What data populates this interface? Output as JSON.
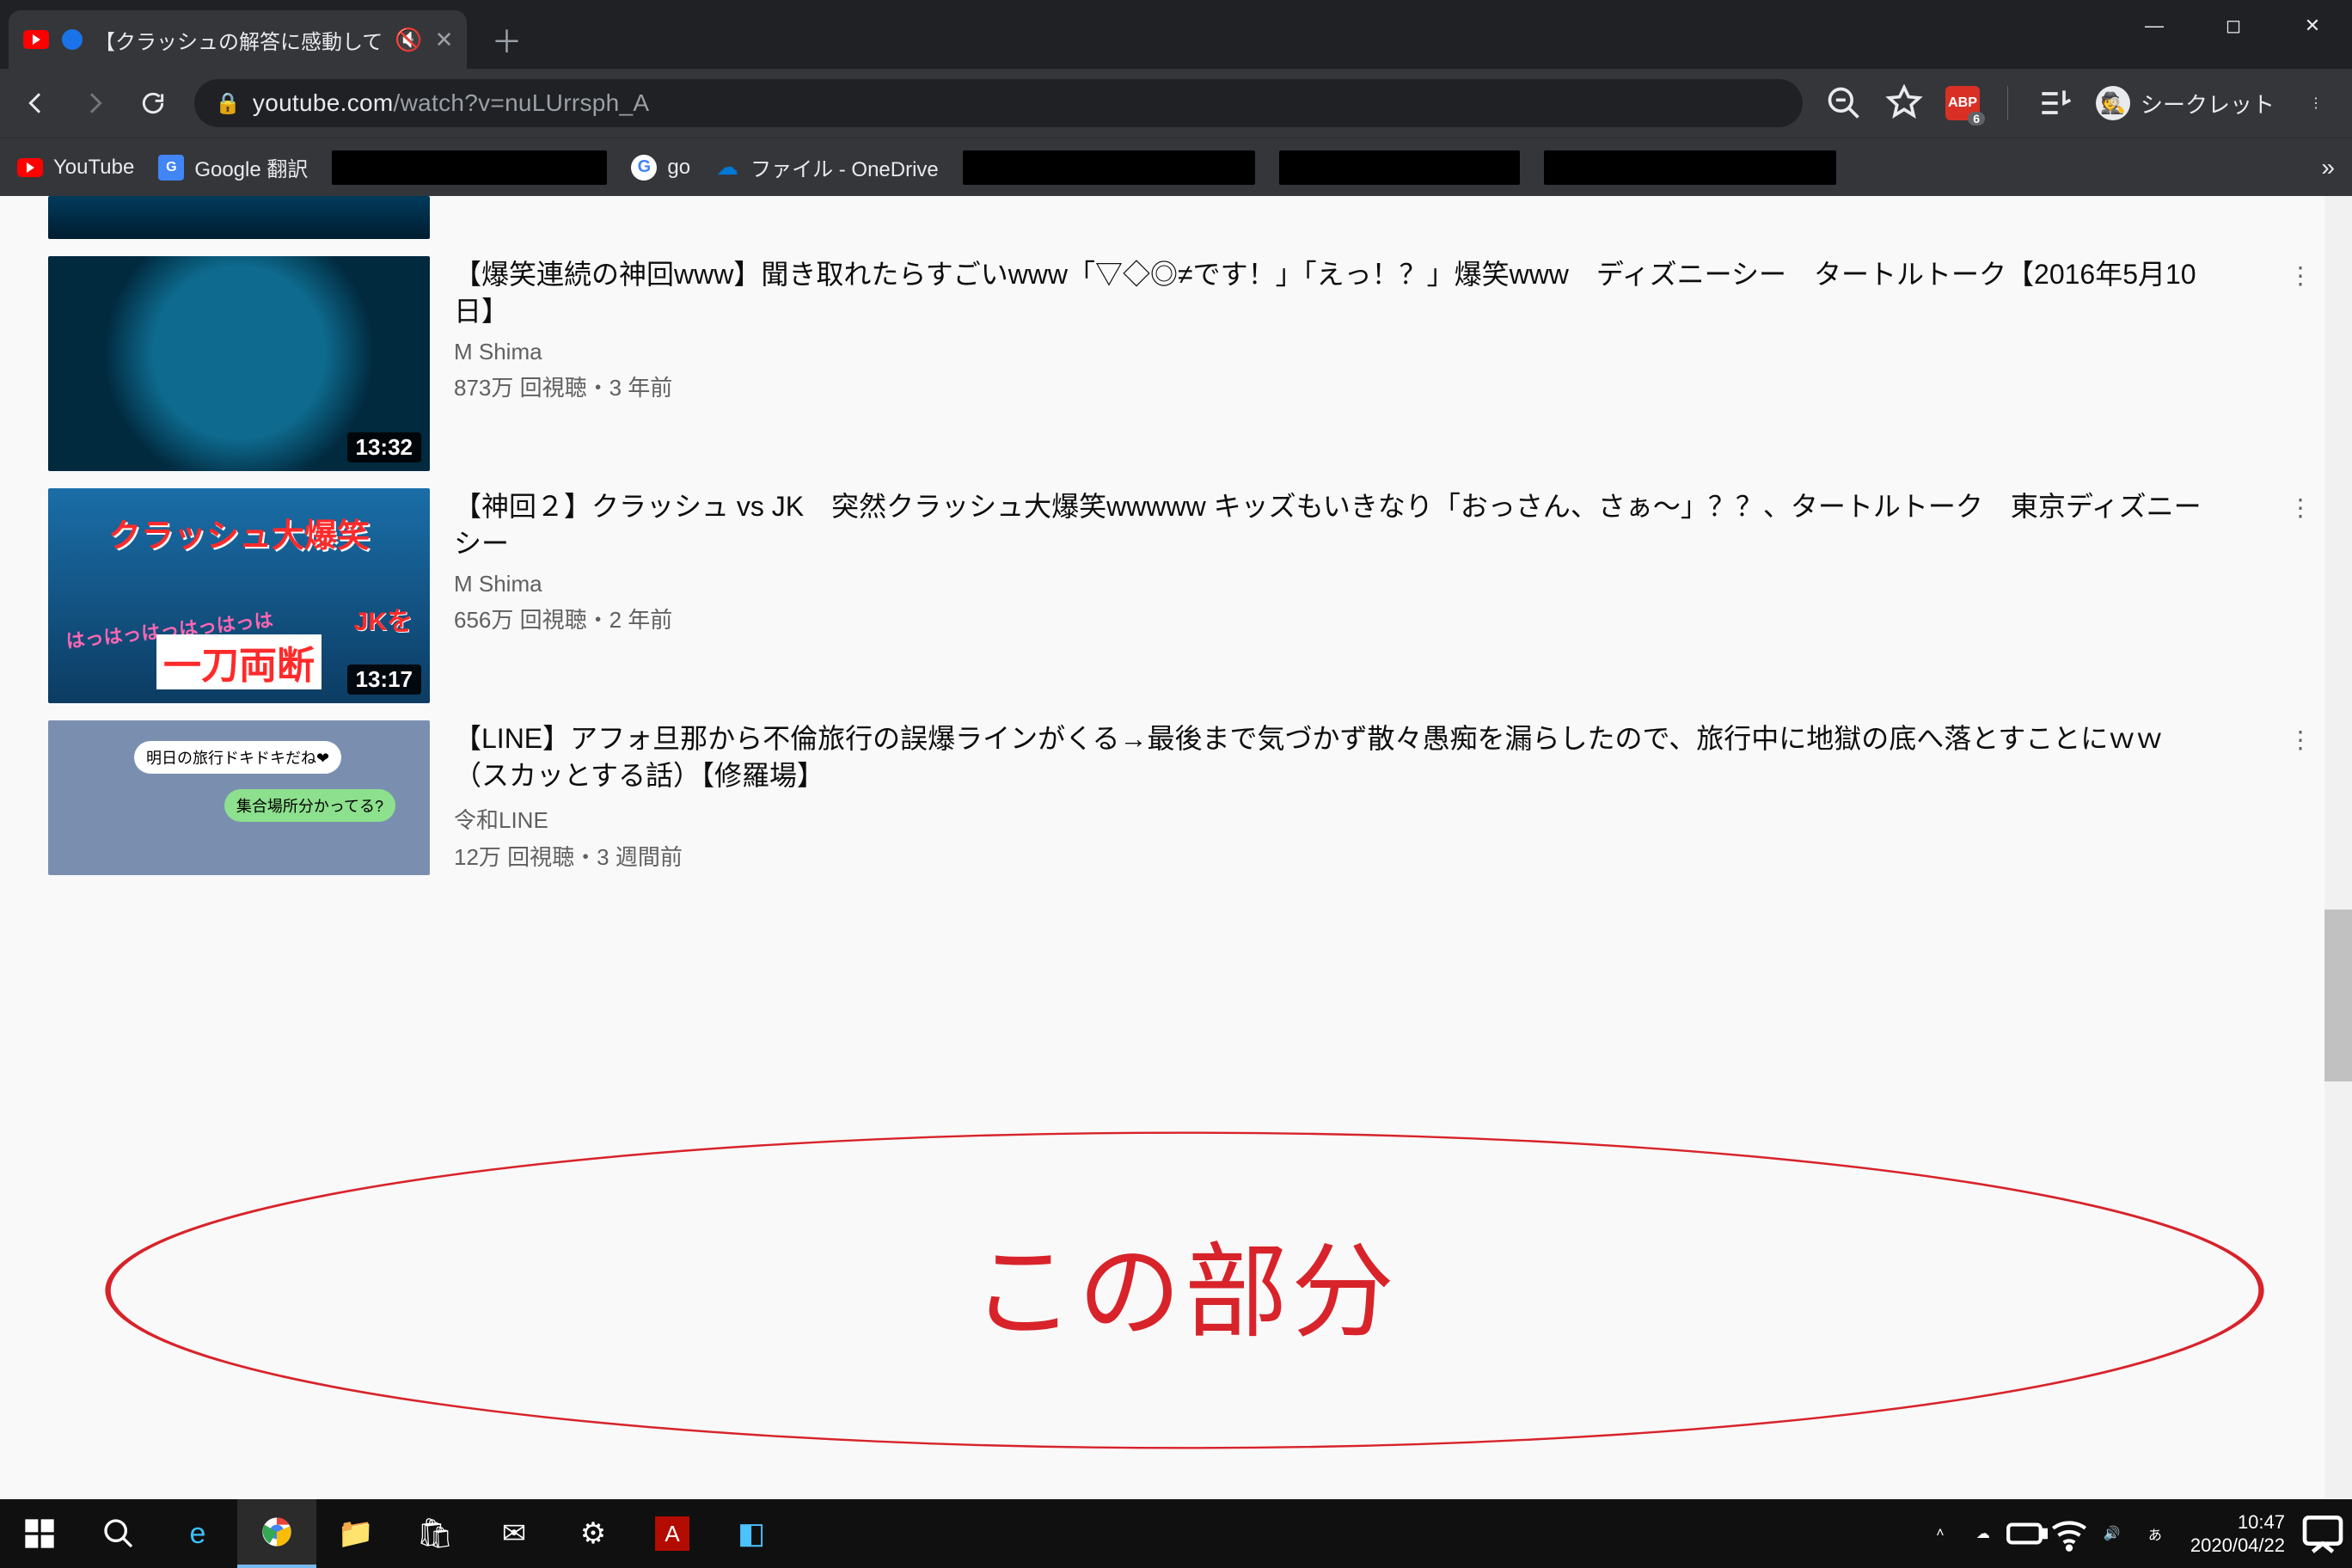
{
  "window": {
    "tab_title": "【クラッシュの解答に感動して"
  },
  "url": {
    "host": "youtube.com",
    "path": "/watch?v=nuLUrrsph_A"
  },
  "abp_badge": "6",
  "incognito_label": "シークレット",
  "bookmarks": {
    "b0": "YouTube",
    "b1": "Google 翻訳",
    "b3": "go",
    "b4": "ファイル - OneDrive"
  },
  "videos": [
    {
      "title": "",
      "channel": "",
      "stats": "",
      "duration": ""
    },
    {
      "title": "【爆笑連続の神回www】聞き取れたらすごいwww「▽◇◎≠です！」「えっ！？」爆笑www　ディズニーシー　タートルトーク【2016年5月10日】",
      "channel": "M Shima",
      "stats": "873万 回視聴・3 年前",
      "duration": "13:32"
    },
    {
      "title": "【神回２】クラッシュ vs JK　突然クラッシュ大爆笑wwwww キッズもいきなり「おっさん、さぁ〜」？？、タートルトーク　東京ディズニーシー",
      "channel": "M Shima",
      "stats": "656万 回視聴・2 年前",
      "duration": "13:17",
      "thumb_text": {
        "a": "クラッシュ大爆笑",
        "b": "JKを",
        "c": "一刀両断",
        "d": "はっはっはっはっはっは"
      }
    },
    {
      "title": "【LINE】アフォ旦那から不倫旅行の誤爆ラインがくる→最後まで気づかず散々愚痴を漏らしたので、旅行中に地獄の底へ落とすことにｗｗ（スカッとする話）【修羅場】",
      "channel": "令和LINE",
      "stats": "12万 回視聴・3 週間前",
      "duration": "",
      "thumb_text": {
        "a": "明日の旅行ドキドキだね❤",
        "b": "集合場所分かってる?"
      }
    }
  ],
  "annotation": "この部分",
  "taskbar": {
    "time": "10:47",
    "date": "2020/04/22"
  }
}
